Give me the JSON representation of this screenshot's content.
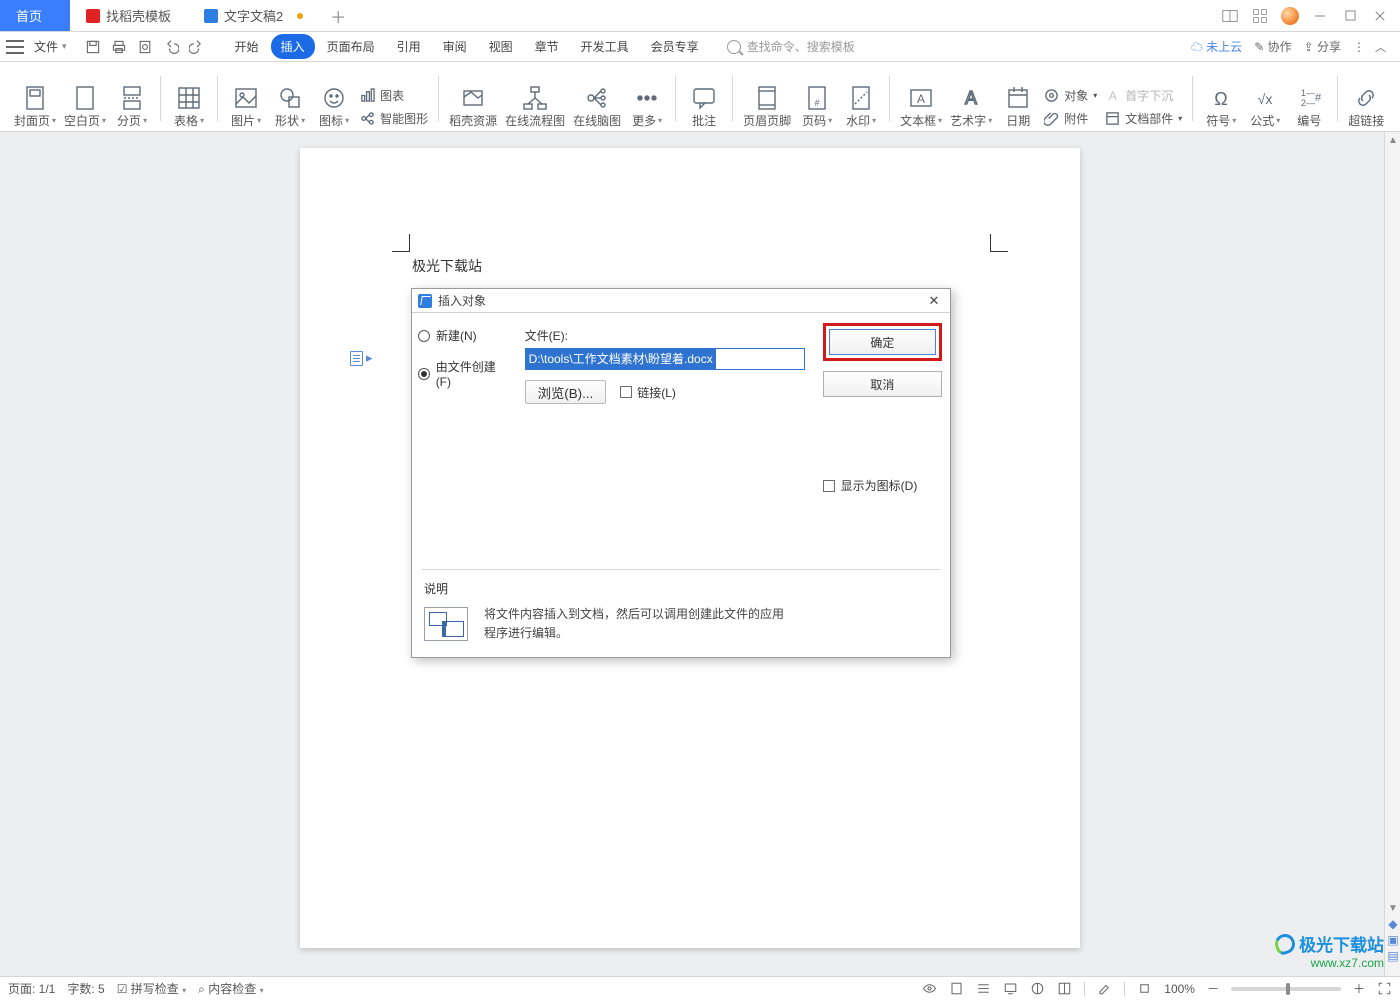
{
  "tabs": {
    "home": "首页",
    "templates": "找稻壳模板",
    "doc": "文字文稿2"
  },
  "menu": {
    "file": "文件",
    "tabs": [
      "开始",
      "插入",
      "页面布局",
      "引用",
      "审阅",
      "视图",
      "章节",
      "开发工具",
      "会员专享"
    ],
    "active_index": 1,
    "search_placeholder": "查找命令、搜索模板",
    "cloud": "未上云",
    "coop": "协作",
    "share": "分享"
  },
  "ribbon": {
    "cover": "封面页",
    "blank": "空白页",
    "break": "分页",
    "table": "表格",
    "picture": "图片",
    "shapes": "形状",
    "icons": "图标",
    "chart": "图表",
    "smart": "智能图形",
    "assets": "稻壳资源",
    "flow": "在线流程图",
    "mind": "在线脑图",
    "more": "更多",
    "comment": "批注",
    "headerfooter": "页眉页脚",
    "pagenum": "页码",
    "watermark": "水印",
    "textbox": "文本框",
    "wordart": "艺术字",
    "date": "日期",
    "object": "对象",
    "attach": "附件",
    "dropcap": "首字下沉",
    "docparts": "文档部件",
    "symbol": "符号",
    "equation": "公式",
    "numbering": "编号",
    "hyperlink": "超链接"
  },
  "page_text": "极光下载站",
  "dialog": {
    "title": "插入对象",
    "radio_new": "新建(N)",
    "radio_file": "由文件创建(F)",
    "file_label": "文件(E):",
    "file_value": "D:\\tools\\工作文档素材\\盼望着.docx",
    "browse": "浏览(B)...",
    "link": "链接(L)",
    "as_icon": "显示为图标(D)",
    "ok": "确定",
    "cancel": "取消",
    "desc_h": "说明",
    "desc_t": "将文件内容插入到文档，然后可以调用创建此文件的应用程序进行编辑。"
  },
  "status": {
    "page": "页面: 1/1",
    "words": "字数: 5",
    "spell": "拼写检查",
    "content": "内容检查",
    "zoom": "100%"
  },
  "watermark": {
    "l1": "极光下载站",
    "l2": "www.xz7.com"
  }
}
